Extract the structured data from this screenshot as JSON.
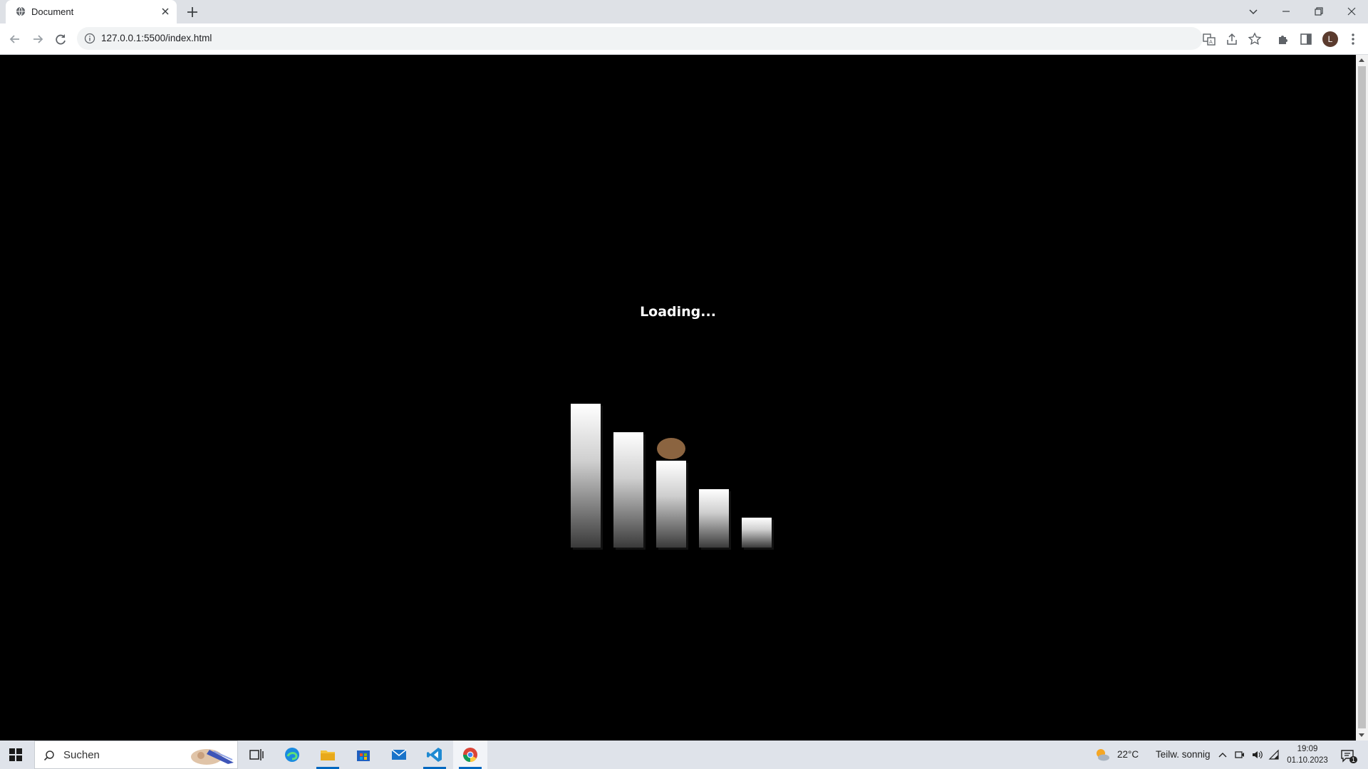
{
  "browser": {
    "tab_title": "Document",
    "url": "127.0.0.1:5500/index.html",
    "profile_initial": "L"
  },
  "page": {
    "loading_text": "Loading...",
    "bar_heights": [
      1.0,
      0.8,
      0.6,
      0.4,
      0.2
    ],
    "colors": {
      "background": "#000000",
      "ball": "#8b6440",
      "bar_top": "#ffffff",
      "bar_bottom": "#3a3a3a"
    }
  },
  "taskbar": {
    "search_placeholder": "Suchen",
    "apps": [
      "task-view",
      "edge",
      "file-explorer",
      "microsoft-store",
      "mail",
      "vs-code",
      "chrome"
    ],
    "weather_temp": "22°C",
    "weather_desc": "Teilw. sonnig",
    "time": "19:09",
    "date": "01.10.2023",
    "notification_count": "1"
  }
}
